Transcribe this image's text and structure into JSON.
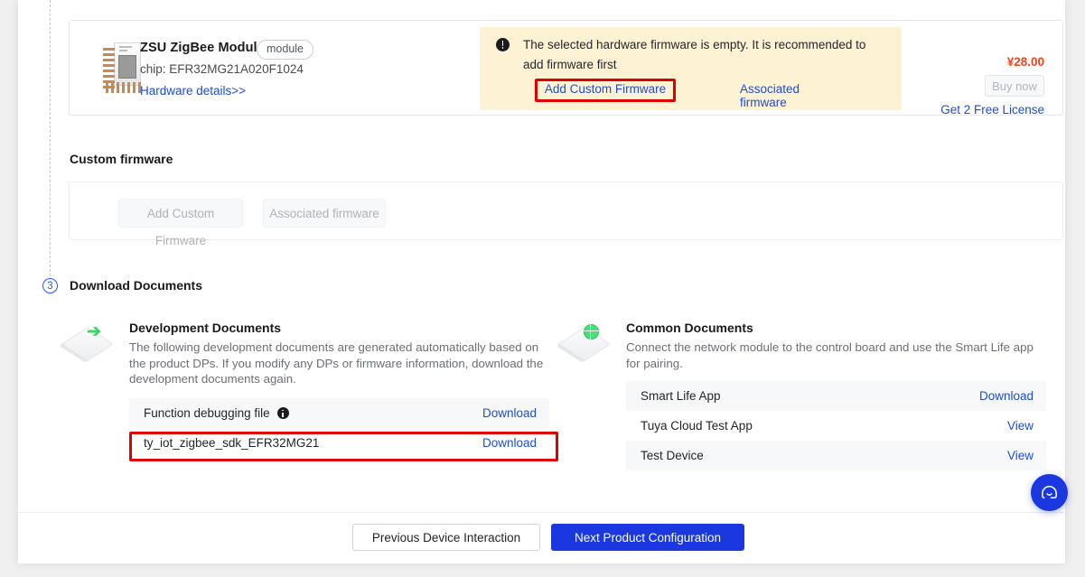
{
  "module_card": {
    "thumbnail_icon": "zigbee-module-photo",
    "name": "ZSU ZigBee Module",
    "tag": "module",
    "chip": "chip: EFR32MG21A020F1024",
    "hardware_details_link": "Hardware details>>",
    "price": "¥28.00",
    "buy_button": "Buy now",
    "free_license_link": "Get 2 Free License"
  },
  "warning": {
    "icon": "exclamation-circle-icon",
    "message": "The selected hardware firmware is empty. It is recommended to add firmware first",
    "add_firmware_link": "Add Custom Firmware",
    "associated_firmware_link": "Associated firmware",
    "background_color": "#fdf3d4",
    "highlight_color": "#e00000"
  },
  "custom_firmware": {
    "title": "Custom firmware",
    "add_button": "Add Custom Firmware",
    "associated_button": "Associated firmware"
  },
  "step3": {
    "number": "3",
    "title": "Download Documents"
  },
  "development_documents": {
    "icon": "development-documents-icon",
    "title": "Development Documents",
    "description": "The following development documents are generated automatically based on the product DPs. If you modify any DPs or firmware information, download the development documents again.",
    "rows": [
      {
        "label": "Function debugging file",
        "has_info_icon": true,
        "action": "Download",
        "shaded": true,
        "highlighted": false
      },
      {
        "label": "ty_iot_zigbee_sdk_EFR32MG21",
        "has_info_icon": false,
        "action": "Download",
        "shaded": false,
        "highlighted": true
      }
    ]
  },
  "common_documents": {
    "icon": "common-documents-icon",
    "title": "Common Documents",
    "description": "Connect the network module to the control board and use the Smart Life app for pairing.",
    "rows": [
      {
        "label": "Smart Life App",
        "has_info_icon": false,
        "action": "Download",
        "shaded": true,
        "highlighted": false
      },
      {
        "label": "Tuya Cloud Test App",
        "has_info_icon": false,
        "action": "View",
        "shaded": false,
        "highlighted": false
      },
      {
        "label": "Test Device",
        "has_info_icon": false,
        "action": "View",
        "shaded": true,
        "highlighted": false
      }
    ]
  },
  "footer": {
    "previous_button": "Previous Device Interaction",
    "next_button": "Next Product Configuration",
    "primary_color": "#1b38e0"
  },
  "support": {
    "icon": "headset-chat-icon",
    "color": "#1b38e0"
  }
}
